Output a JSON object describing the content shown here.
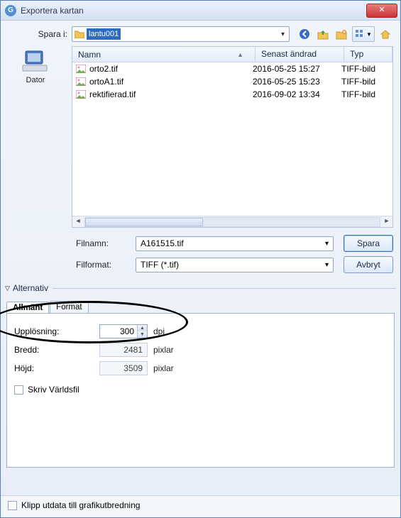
{
  "title": "Exportera kartan",
  "labels": {
    "save_in": "Spara i:",
    "filename": "Filnamn:",
    "fileformat": "Filformat:",
    "alternative": "Alternativ",
    "resolution": "Upplösning:",
    "width": "Bredd:",
    "height": "Höjd:",
    "dpi": "dpi",
    "pixels": "pixlar"
  },
  "path": {
    "folder": "lantu001"
  },
  "places": {
    "computer": "Dator"
  },
  "columns": {
    "name": "Namn",
    "modified": "Senast ändrad",
    "type": "Typ"
  },
  "files": [
    {
      "name": "orto2.tif",
      "date": "2016-05-25 15:27",
      "type": "TIFF-bild"
    },
    {
      "name": "ortoA1.tif",
      "date": "2016-05-25 15:23",
      "type": "TIFF-bild"
    },
    {
      "name": "rektifierad.tif",
      "date": "2016-09-02 13:34",
      "type": "TIFF-bild"
    }
  ],
  "filename_value": "A161515.tif",
  "format_value": "TIFF (*.tif)",
  "buttons": {
    "save": "Spara",
    "cancel": "Avbryt"
  },
  "tabs": {
    "general": "Allmänt",
    "format": "Format"
  },
  "form": {
    "resolution": "300",
    "width": "2481",
    "height": "3509",
    "worldfile": "Skriv Världsfil"
  },
  "footer": {
    "clip": "Klipp utdata till grafikutbredning"
  }
}
